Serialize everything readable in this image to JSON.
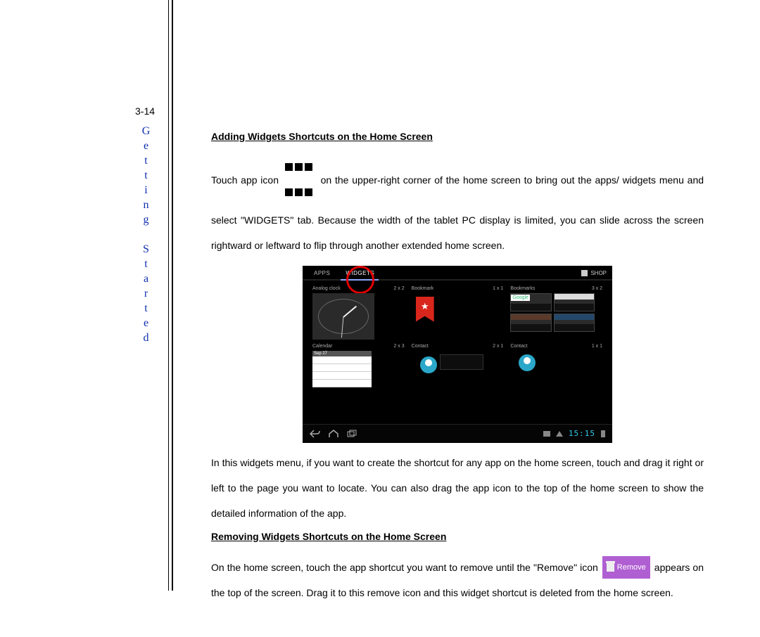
{
  "page_number": "3-14",
  "side_label": "Getting Started",
  "heading1": "Adding Widgets Shortcuts on the Home Screen",
  "para1a": "Touch app icon",
  "para1b": "on the upper-right corner of the home screen to bring out the apps/ widgets menu and select \"WIDGETS\" tab. Because the width of the tablet PC display is limited, you can slide across the screen rightward or leftward to flip through another extended home screen.",
  "para2": "In this widgets menu, if you want to create the shortcut for any app on the home screen, touch and drag it right or left to the page you want to locate. You can also drag the app icon to the top of the home screen to show the detailed information of the app.",
  "heading2": "Removing Widgets Shortcuts on the Home Screen",
  "para3a": "On the home screen, touch the app shortcut you want to remove until the \"Remove\" icon",
  "para3b": "appears on the top of the screen. Drag it to this remove icon and this widget shortcut is deleted from the home screen.",
  "remove_label": "Remove",
  "tablet": {
    "tabs": {
      "apps": "APPS",
      "widgets": "WIDGETS"
    },
    "shop": "SHOP",
    "row1": {
      "a": {
        "name": "Analog clock",
        "size": "2 x 2"
      },
      "b": {
        "name": "Bookmark",
        "size": "1 x 1"
      },
      "c": {
        "name": "Bookmarks",
        "size": "3 x 2",
        "google": "Google"
      }
    },
    "row2": {
      "a": {
        "name": "Calendar",
        "size": "2 x 3",
        "date": "Sep 27"
      },
      "b": {
        "name": "Contact",
        "size": "2 x 1"
      },
      "c": {
        "name": "Contact",
        "size": "1 x 1"
      }
    },
    "clock": "15:15"
  }
}
